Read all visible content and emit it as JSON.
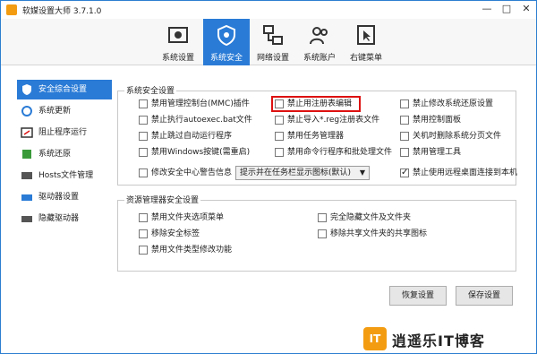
{
  "window": {
    "title": "软媒设置大师 3.7.1.0",
    "controls": [
      "—",
      "□",
      "✕"
    ]
  },
  "toolbar": [
    {
      "label": "系统设置",
      "icon": "settings-icon",
      "active": false
    },
    {
      "label": "系统安全",
      "icon": "shield-icon",
      "active": true
    },
    {
      "label": "网络设置",
      "icon": "network-icon",
      "active": false
    },
    {
      "label": "系统账户",
      "icon": "users-icon",
      "active": false
    },
    {
      "label": "右键菜单",
      "icon": "cursor-icon",
      "active": false
    }
  ],
  "sidebar": [
    {
      "label": "安全综合设置",
      "icon": "shield-icon",
      "active": true
    },
    {
      "label": "系统更新",
      "icon": "refresh-icon",
      "active": false
    },
    {
      "label": "阻止程序运行",
      "icon": "block-icon",
      "active": false
    },
    {
      "label": "系统还原",
      "icon": "restore-icon",
      "active": false
    },
    {
      "label": "Hosts文件管理",
      "icon": "hosts-icon",
      "active": false
    },
    {
      "label": "驱动器设置",
      "icon": "drive-icon",
      "active": false
    },
    {
      "label": "隐藏驱动器",
      "icon": "hidden-drive-icon",
      "active": false
    }
  ],
  "security": {
    "title": "系统安全设置",
    "col1": [
      {
        "label": "禁用管理控制台(MMC)插件",
        "checked": false
      },
      {
        "label": "禁止执行autoexec.bat文件",
        "checked": false
      },
      {
        "label": "禁止跳过自动运行程序",
        "checked": false
      },
      {
        "label": "禁用Windows按键(需重启)",
        "checked": false
      },
      {
        "label": "修改安全中心警告信息",
        "checked": false
      }
    ],
    "col2": [
      {
        "label": "禁止用注册表编辑",
        "checked": false
      },
      {
        "label": "禁止导入*.reg注册表文件",
        "checked": false
      },
      {
        "label": "禁用任务管理器",
        "checked": false
      },
      {
        "label": "禁用命令行程序和批处理文件",
        "checked": false
      }
    ],
    "col3": [
      {
        "label": "禁止修改系统还原设置",
        "checked": false
      },
      {
        "label": "禁用控制面板",
        "checked": false
      },
      {
        "label": "关机时删除系统分页文件",
        "checked": false
      },
      {
        "label": "禁用管理工具",
        "checked": false
      },
      {
        "label": "禁止使用远程桌面连接到本机",
        "checked": true
      }
    ],
    "select": "提示并在任务栏显示图标(默认)"
  },
  "explorer": {
    "title": "资源管理器安全设置",
    "left": [
      {
        "label": "禁用文件夹选项菜单",
        "checked": false
      },
      {
        "label": "移除安全标签",
        "checked": false
      },
      {
        "label": "禁用文件类型修改功能",
        "checked": false
      }
    ],
    "right": [
      {
        "label": "完全隐藏文件及文件夹",
        "checked": false
      },
      {
        "label": "移除共享文件夹的共享图标",
        "checked": false
      }
    ]
  },
  "buttons": {
    "restore": "恢复设置",
    "save": "保存设置"
  },
  "brand": {
    "logo": "IT",
    "name": "逍遥乐IT博客"
  }
}
